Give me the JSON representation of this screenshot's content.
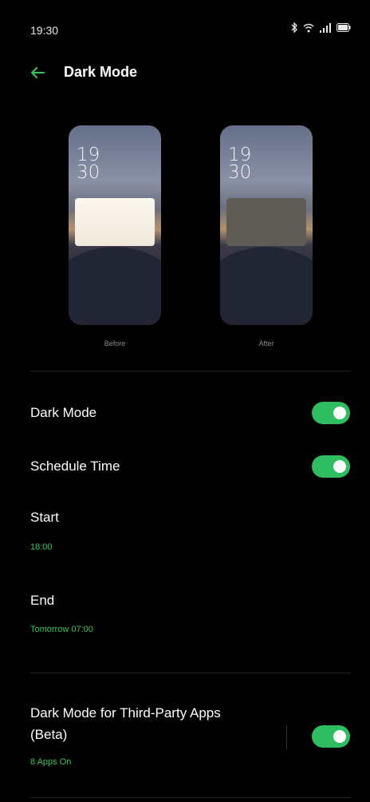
{
  "status_bar": {
    "time": "19:30",
    "icons": [
      "bluetooth-icon",
      "wifi-icon",
      "signal-icon",
      "battery-icon"
    ]
  },
  "header": {
    "back_icon": "arrow-left-icon",
    "title": "Dark Mode"
  },
  "preview": {
    "before": {
      "clock_hour": "19",
      "clock_minute": "30",
      "caption": "Before"
    },
    "after": {
      "clock_hour": "19",
      "clock_minute": "30",
      "caption": "After"
    }
  },
  "settings": {
    "dark_mode": {
      "label": "Dark Mode",
      "enabled": true
    },
    "schedule_time": {
      "label": "Schedule Time",
      "enabled": true
    },
    "start": {
      "label": "Start",
      "value": "18:00"
    },
    "end": {
      "label": "End",
      "value": "Tomorrow 07:00"
    },
    "third_party": {
      "label_line1": "Dark Mode for Third-Party Apps",
      "label_line2": "(Beta)",
      "subtitle": "8 Apps On",
      "enabled": true
    }
  },
  "colors": {
    "accent": "#34c759",
    "toggle_on": "#2fbd62",
    "background": "#000000"
  }
}
